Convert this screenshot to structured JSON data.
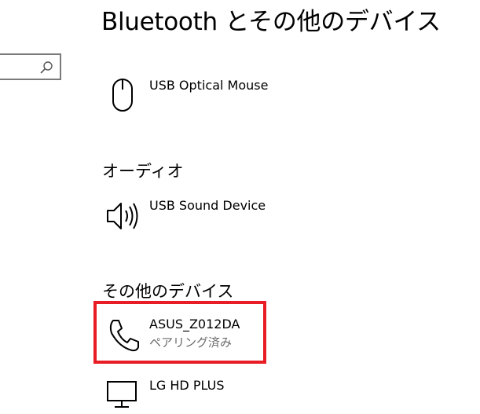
{
  "header": {
    "title": "Bluetooth とその他のデバイス"
  },
  "search": {
    "placeholder": ""
  },
  "devices_mouse": {
    "name": "USB Optical Mouse",
    "icon": "mouse-icon"
  },
  "audio": {
    "heading": "オーディオ",
    "device_name": "USB Sound Device",
    "icon": "speaker-icon"
  },
  "other": {
    "heading": "その他のデバイス",
    "items": [
      {
        "name": "ASUS_Z012DA",
        "status": "ペアリング済み",
        "icon": "phone-icon"
      },
      {
        "name": "LG HD PLUS",
        "status": "",
        "icon": "monitor-icon"
      }
    ]
  },
  "colors": {
    "highlight": "#e81c24",
    "status_text": "#6b6b6b",
    "search_border": "#7a7a7a"
  }
}
